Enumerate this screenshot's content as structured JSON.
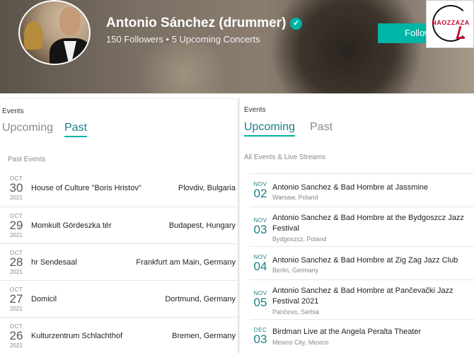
{
  "artist": {
    "name": "Antonio Sánchez (drummer)",
    "stats": "150 Followers • 5 Upcoming Concerts",
    "follow_label": "Follow"
  },
  "logo": {
    "text": "NAOZZAZA"
  },
  "left_panel": {
    "events_label": "Events",
    "tabs": [
      "Upcoming",
      "Past"
    ],
    "active_tab": "Past",
    "section_label": "Past Events",
    "events": [
      {
        "month": "OCT",
        "day": "30",
        "year": "2021",
        "venue": "House of Culture \"Boris Hristov\"",
        "location": "Plovdiv, Bulgaria"
      },
      {
        "month": "OCT",
        "day": "29",
        "year": "2021",
        "venue": "Momkult Gördeszka tér",
        "location": "Budapest, Hungary"
      },
      {
        "month": "OCT",
        "day": "28",
        "year": "2021",
        "venue": "hr Sendesaal",
        "location": "Frankfurt am Main, Germany"
      },
      {
        "month": "OCT",
        "day": "27",
        "year": "2021",
        "venue": "Domicil",
        "location": "Dortmund, Germany"
      },
      {
        "month": "OCT",
        "day": "26",
        "year": "2021",
        "venue": "Kulturzentrum Schlachthof",
        "location": "Bremen, Germany"
      }
    ]
  },
  "right_panel": {
    "events_label": "Events",
    "tabs": [
      "Upcoming",
      "Past"
    ],
    "active_tab": "Upcoming",
    "section_label": "All Events & Live Streams",
    "events": [
      {
        "month": "NOV",
        "day": "02",
        "title": "Antonio Sanchez & Bad Hombre at Jassmine",
        "location": "Warsaw, Poland"
      },
      {
        "month": "NOV",
        "day": "03",
        "title": "Antonio Sanchez & Bad Hombre at the Bydgoszcz Jazz Festival",
        "location": "Bydgoszcz, Poland"
      },
      {
        "month": "NOV",
        "day": "04",
        "title": "Antonio Sanchez & Bad Hombre at Zig Zag Jazz Club",
        "location": "Berlin, Germany"
      },
      {
        "month": "NOV",
        "day": "05",
        "title": "Antonio Sanchez & Bad Hombre at Pančevački Jazz Festival 2021",
        "location": "Pančevo, Serbia"
      },
      {
        "month": "DEC",
        "day": "03",
        "title": "Birdman Live at the Angela Peralta Theater",
        "location": "Mexico City, Mexico"
      }
    ]
  },
  "colors": {
    "accent": "#00b4a6",
    "accent_text": "#1a7f86"
  },
  "icons": {
    "verified": "verified-check-icon"
  }
}
